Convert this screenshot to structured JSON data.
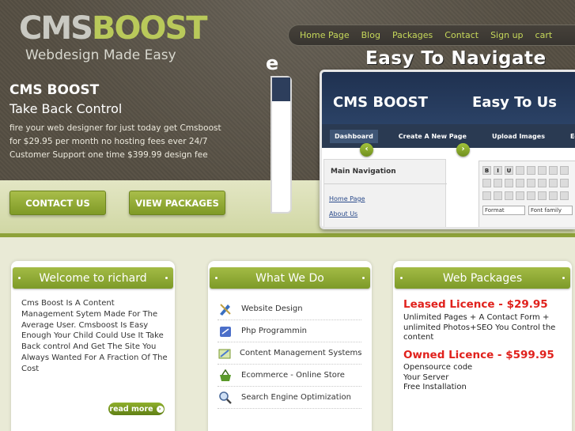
{
  "logo": {
    "part1": "CMS",
    "part2": "BOOST",
    "tagline": "Webdesign Made Easy"
  },
  "nav": [
    "Home Page",
    "Blog",
    "Packages",
    "Contact",
    "Sign up",
    "cart"
  ],
  "hero": {
    "title": "CMS BOOST",
    "subtitle": "Take Back Control",
    "text": "fire your web designer for just today get Cmsboost for $29.95 per month no hosting fees ever 24/7 Customer Support one time $399.99 design fee",
    "contact_button": "CONTACT US",
    "packages_button": "VIEW PACKAGES"
  },
  "slider": {
    "prev_label_fragment": "e",
    "title": "Easy To Navigate",
    "screenshot": {
      "brand": "CMS BOOST",
      "brand_right": "Easy To Us",
      "menu": [
        "Dashboard",
        "Create A New Page",
        "Upload Images",
        "Edit Navigation"
      ],
      "panel_title": "Main Navigation",
      "links": [
        "Home Page",
        "About Us"
      ],
      "editor_format": "Format",
      "editor_font": "Font family"
    },
    "prev_arrow": "‹",
    "next_arrow": "›"
  },
  "welcome": {
    "heading": "Welcome to richard",
    "text": "Cms Boost Is A Content Management Sytem Made For The Average User. Cmsboost Is Easy Enough Your Child Could Use It Take Back control And Get The Site You Always Wanted For A Fraction Of The Cost",
    "read_more": "read more"
  },
  "what_we_do": {
    "heading": "What We Do",
    "items": [
      {
        "label": "Website Design",
        "icon": "design-tools-icon"
      },
      {
        "label": "Php Programmin",
        "icon": "php-icon"
      },
      {
        "label": "Content Management Systems",
        "icon": "cms-edit-icon"
      },
      {
        "label": "Ecommerce - Online Store",
        "icon": "shopping-basket-icon"
      },
      {
        "label": "Search Engine Optimization",
        "icon": "magnifier-icon"
      }
    ]
  },
  "packages": {
    "heading": "Web Packages",
    "leased_title": "Leased Licence - ",
    "leased_price": "$29.95",
    "leased_text": "Unlimited Pages +  A Contact Form + unlimited Photos+SEO You Control the content",
    "owned_title": "Owned Licence - ",
    "owned_price": "$599.95",
    "owned_text_lines": [
      "Opensource code",
      "Your Server",
      "Free Installation"
    ]
  },
  "colors": {
    "accent": "#8ea23a",
    "price": "#e0211c",
    "nav_text": "#c6d85a"
  }
}
